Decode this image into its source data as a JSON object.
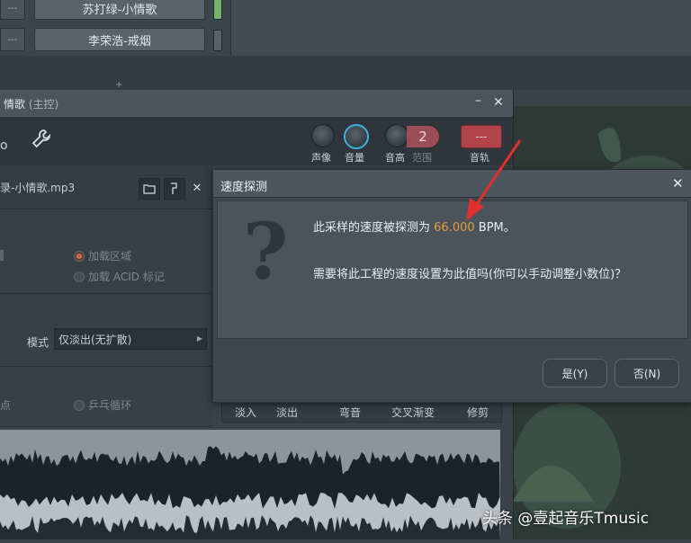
{
  "channel_rack": {
    "rows": [
      {
        "left_label": "---",
        "name": "苏打绿-小情歌",
        "led_color": "#78b36b"
      },
      {
        "left_label": "---",
        "name": "李荣浩-戒烟",
        "led_color": "#59626a"
      }
    ]
  },
  "channel_window": {
    "title": "情歌",
    "title_suffix": "(主控)",
    "tool_partial": "o",
    "knobs": [
      {
        "label": "声像"
      },
      {
        "label": "音量"
      },
      {
        "label": "音高"
      }
    ],
    "pitch_range_value": "2",
    "pitch_range_label": "范围",
    "track_value": "---",
    "track_label": "音轨",
    "file_name": "录-小情歌.mp3",
    "load_region_label": "加载区域",
    "load_acid_label": "加载 ACID 标记",
    "mode_label": "模式",
    "mode_value": "仅淡出(无扩散)",
    "loop_point_label": "点",
    "pingpong_label": "乒乓循环",
    "env_tabs": [
      "淡入",
      "淡出",
      "弯音",
      "交叉渐变",
      "修剪"
    ]
  },
  "dialog": {
    "title": "速度探测",
    "message_prefix": "此采样的速度被探测为",
    "bpm_value": "66.000",
    "bpm_unit": "BPM",
    "message_end": "。",
    "question": "需要将此工程的速度设置为此值吗(你可以手动调整小数位)？",
    "yes_label": "是(Y)",
    "no_label": "否(N)",
    "accent_color": "#e39a3b"
  },
  "watermark": "头条 @壹起音乐Tmusic"
}
